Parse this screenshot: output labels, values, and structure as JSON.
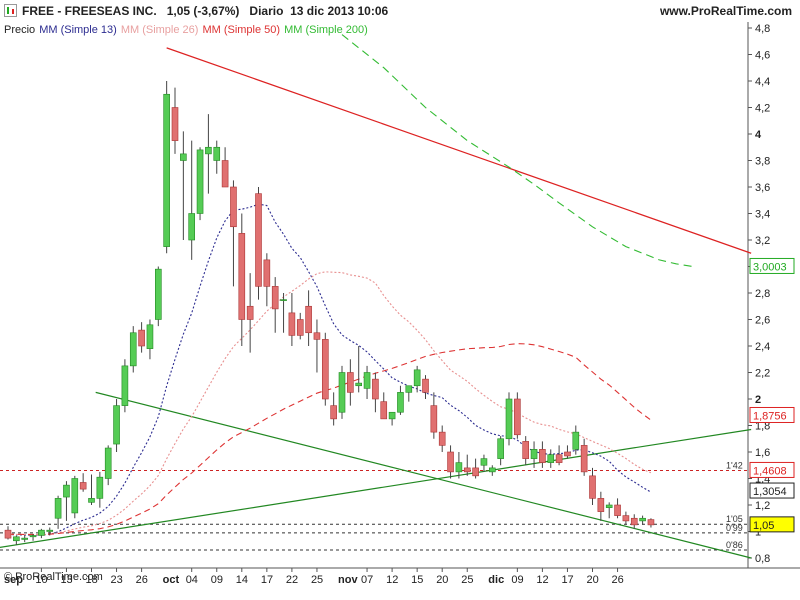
{
  "header": {
    "symbol": "FREE - FREESEAS INC.",
    "quote": "1,05 (-3,67%)",
    "period": "Diario",
    "datetime": "13 dic 2013 10:06",
    "website": "www.ProRealTime.com",
    "icon": "chart-type-icon"
  },
  "copyright": "© ProRealTime.com",
  "legend": [
    {
      "text": "Precio",
      "color": "#222222"
    },
    {
      "text": "MM (Simple 13)",
      "color": "#2c2c90"
    },
    {
      "text": "MM (Simple 26)",
      "color": "#e8a0a0"
    },
    {
      "text": "MM (Simple 50)",
      "color": "#dd3333"
    },
    {
      "text": "MM (Simple 200)",
      "color": "#33bb33"
    }
  ],
  "chart_data": {
    "type": "candlestick",
    "y_axis": {
      "min": 0.8,
      "max": 4.8,
      "ticks": [
        "4,8",
        "4,6",
        "4,4",
        "4,2",
        "4",
        "3,8",
        "3,6",
        "3,4",
        "3,2",
        "3",
        "2,8",
        "2,6",
        "2,4",
        "2,2",
        "2",
        "1,8",
        "1,6",
        "1,4",
        "1,2",
        "1",
        "0,8"
      ],
      "tick_values": [
        4.8,
        4.6,
        4.4,
        4.2,
        4.0,
        3.8,
        3.6,
        3.4,
        3.2,
        3.0,
        2.8,
        2.6,
        2.4,
        2.2,
        2.0,
        1.8,
        1.6,
        1.4,
        1.2,
        1.0,
        0.8
      ]
    },
    "x_axis": {
      "labels": [
        "sep",
        "10",
        "13",
        "18",
        "23",
        "26",
        "oct",
        "04",
        "09",
        "14",
        "17",
        "22",
        "25",
        "nov",
        "07",
        "12",
        "15",
        "20",
        "25",
        "dic",
        "09",
        "12",
        "17",
        "20",
        "26"
      ],
      "label_slots": [
        -1,
        4,
        7,
        10,
        13,
        16,
        19,
        22,
        25,
        28,
        31,
        34,
        37,
        40,
        43,
        46,
        49,
        52,
        55,
        58,
        61,
        64,
        67,
        70,
        73
      ]
    },
    "candles": [
      [
        1.01,
        1.04,
        0.94,
        0.95
      ],
      [
        0.93,
        0.97,
        0.9,
        0.96
      ],
      [
        0.94,
        0.97,
        0.92,
        0.95
      ],
      [
        0.96,
        0.98,
        0.93,
        0.97
      ],
      [
        0.97,
        1.02,
        0.95,
        1.01
      ],
      [
        1.0,
        1.03,
        0.97,
        1.01
      ],
      [
        1.1,
        1.27,
        1.02,
        1.25
      ],
      [
        1.26,
        1.38,
        1.08,
        1.35
      ],
      [
        1.14,
        1.42,
        1.1,
        1.4
      ],
      [
        1.37,
        1.44,
        1.3,
        1.32
      ],
      [
        1.22,
        1.43,
        1.2,
        1.25
      ],
      [
        1.25,
        1.45,
        1.18,
        1.41
      ],
      [
        1.4,
        1.65,
        1.35,
        1.63
      ],
      [
        1.66,
        2.0,
        1.6,
        1.95
      ],
      [
        1.95,
        2.3,
        1.9,
        2.25
      ],
      [
        2.25,
        2.55,
        2.2,
        2.5
      ],
      [
        2.52,
        2.58,
        2.35,
        2.4
      ],
      [
        2.38,
        2.6,
        2.3,
        2.56
      ],
      [
        2.6,
        3.0,
        2.55,
        2.98
      ],
      [
        3.15,
        4.4,
        3.1,
        4.3
      ],
      [
        4.2,
        4.35,
        3.85,
        3.95
      ],
      [
        3.8,
        4.02,
        3.2,
        3.85
      ],
      [
        3.2,
        3.95,
        3.05,
        3.4
      ],
      [
        3.4,
        3.9,
        3.35,
        3.88
      ],
      [
        3.85,
        4.15,
        3.55,
        3.9
      ],
      [
        3.8,
        3.95,
        3.7,
        3.9
      ],
      [
        3.8,
        3.9,
        3.6,
        3.6
      ],
      [
        3.6,
        3.65,
        2.85,
        3.3
      ],
      [
        3.25,
        3.4,
        2.4,
        2.6
      ],
      [
        2.7,
        2.95,
        2.35,
        2.6
      ],
      [
        3.55,
        3.6,
        2.75,
        2.85
      ],
      [
        3.05,
        3.1,
        2.7,
        2.85
      ],
      [
        2.85,
        2.92,
        2.5,
        2.68
      ],
      [
        2.75,
        2.8,
        2.5,
        2.75
      ],
      [
        2.65,
        2.8,
        2.4,
        2.48
      ],
      [
        2.6,
        2.65,
        2.45,
        2.48
      ],
      [
        2.7,
        2.82,
        2.4,
        2.5
      ],
      [
        2.5,
        2.6,
        2.2,
        2.45
      ],
      [
        2.45,
        2.5,
        1.95,
        2.0
      ],
      [
        1.95,
        2.05,
        1.8,
        1.85
      ],
      [
        1.9,
        2.25,
        1.85,
        2.2
      ],
      [
        2.2,
        2.3,
        1.95,
        2.05
      ],
      [
        2.1,
        2.4,
        2.05,
        2.12
      ],
      [
        2.08,
        2.25,
        2.0,
        2.2
      ],
      [
        2.15,
        2.2,
        1.9,
        2.0
      ],
      [
        1.98,
        2.05,
        1.85,
        1.85
      ],
      [
        1.85,
        1.9,
        1.8,
        1.9
      ],
      [
        1.9,
        2.1,
        1.88,
        2.05
      ],
      [
        2.05,
        2.1,
        1.98,
        2.1
      ],
      [
        2.1,
        2.25,
        2.05,
        2.22
      ],
      [
        2.15,
        2.18,
        2.0,
        2.05
      ],
      [
        1.95,
        2.05,
        1.7,
        1.75
      ],
      [
        1.75,
        1.8,
        1.6,
        1.65
      ],
      [
        1.6,
        1.65,
        1.4,
        1.45
      ],
      [
        1.45,
        1.6,
        1.4,
        1.52
      ],
      [
        1.48,
        1.58,
        1.42,
        1.45
      ],
      [
        1.48,
        1.55,
        1.4,
        1.42
      ],
      [
        1.5,
        1.58,
        1.45,
        1.55
      ],
      [
        1.45,
        1.5,
        1.42,
        1.48
      ],
      [
        1.55,
        1.72,
        1.5,
        1.7
      ],
      [
        1.7,
        2.05,
        1.65,
        2.0
      ],
      [
        2.0,
        2.05,
        1.7,
        1.73
      ],
      [
        1.68,
        1.72,
        1.5,
        1.55
      ],
      [
        1.55,
        1.68,
        1.48,
        1.62
      ],
      [
        1.62,
        1.68,
        1.48,
        1.52
      ],
      [
        1.52,
        1.62,
        1.48,
        1.58
      ],
      [
        1.58,
        1.65,
        1.5,
        1.52
      ],
      [
        1.6,
        1.65,
        1.55,
        1.57
      ],
      [
        1.62,
        1.8,
        1.58,
        1.75
      ],
      [
        1.65,
        1.7,
        1.42,
        1.45
      ],
      [
        1.42,
        1.48,
        1.2,
        1.25
      ],
      [
        1.25,
        1.3,
        1.08,
        1.15
      ],
      [
        1.18,
        1.22,
        1.1,
        1.2
      ],
      [
        1.2,
        1.25,
        1.1,
        1.12
      ],
      [
        1.12,
        1.15,
        1.05,
        1.08
      ],
      [
        1.1,
        1.13,
        1.02,
        1.05
      ],
      [
        1.08,
        1.12,
        1.05,
        1.1
      ],
      [
        1.09,
        1.1,
        1.03,
        1.05
      ]
    ],
    "value_labels": [
      {
        "text": "3,0003",
        "color": "#22aa22",
        "value": 3.0003
      },
      {
        "text": "1,8756",
        "color": "#dd2222",
        "value": 1.8756
      },
      {
        "text": "1,4608",
        "color": "#dd2222",
        "value": 1.4608
      },
      {
        "text": "1,3054",
        "color": "#222222",
        "value": 1.3054
      },
      {
        "text": "1,05",
        "color": "#222222",
        "value": 1.05,
        "highlight": "#ffff00"
      }
    ],
    "hlines": [
      {
        "text": "1'42",
        "value": 1.46,
        "color": "#cc2222"
      },
      {
        "text": "1'05",
        "value": 1.055,
        "color": "#333333"
      },
      {
        "text": "0'99",
        "value": 0.99,
        "color": "#333333"
      },
      {
        "text": "0'86",
        "value": 0.86,
        "color": "#333333"
      }
    ]
  }
}
